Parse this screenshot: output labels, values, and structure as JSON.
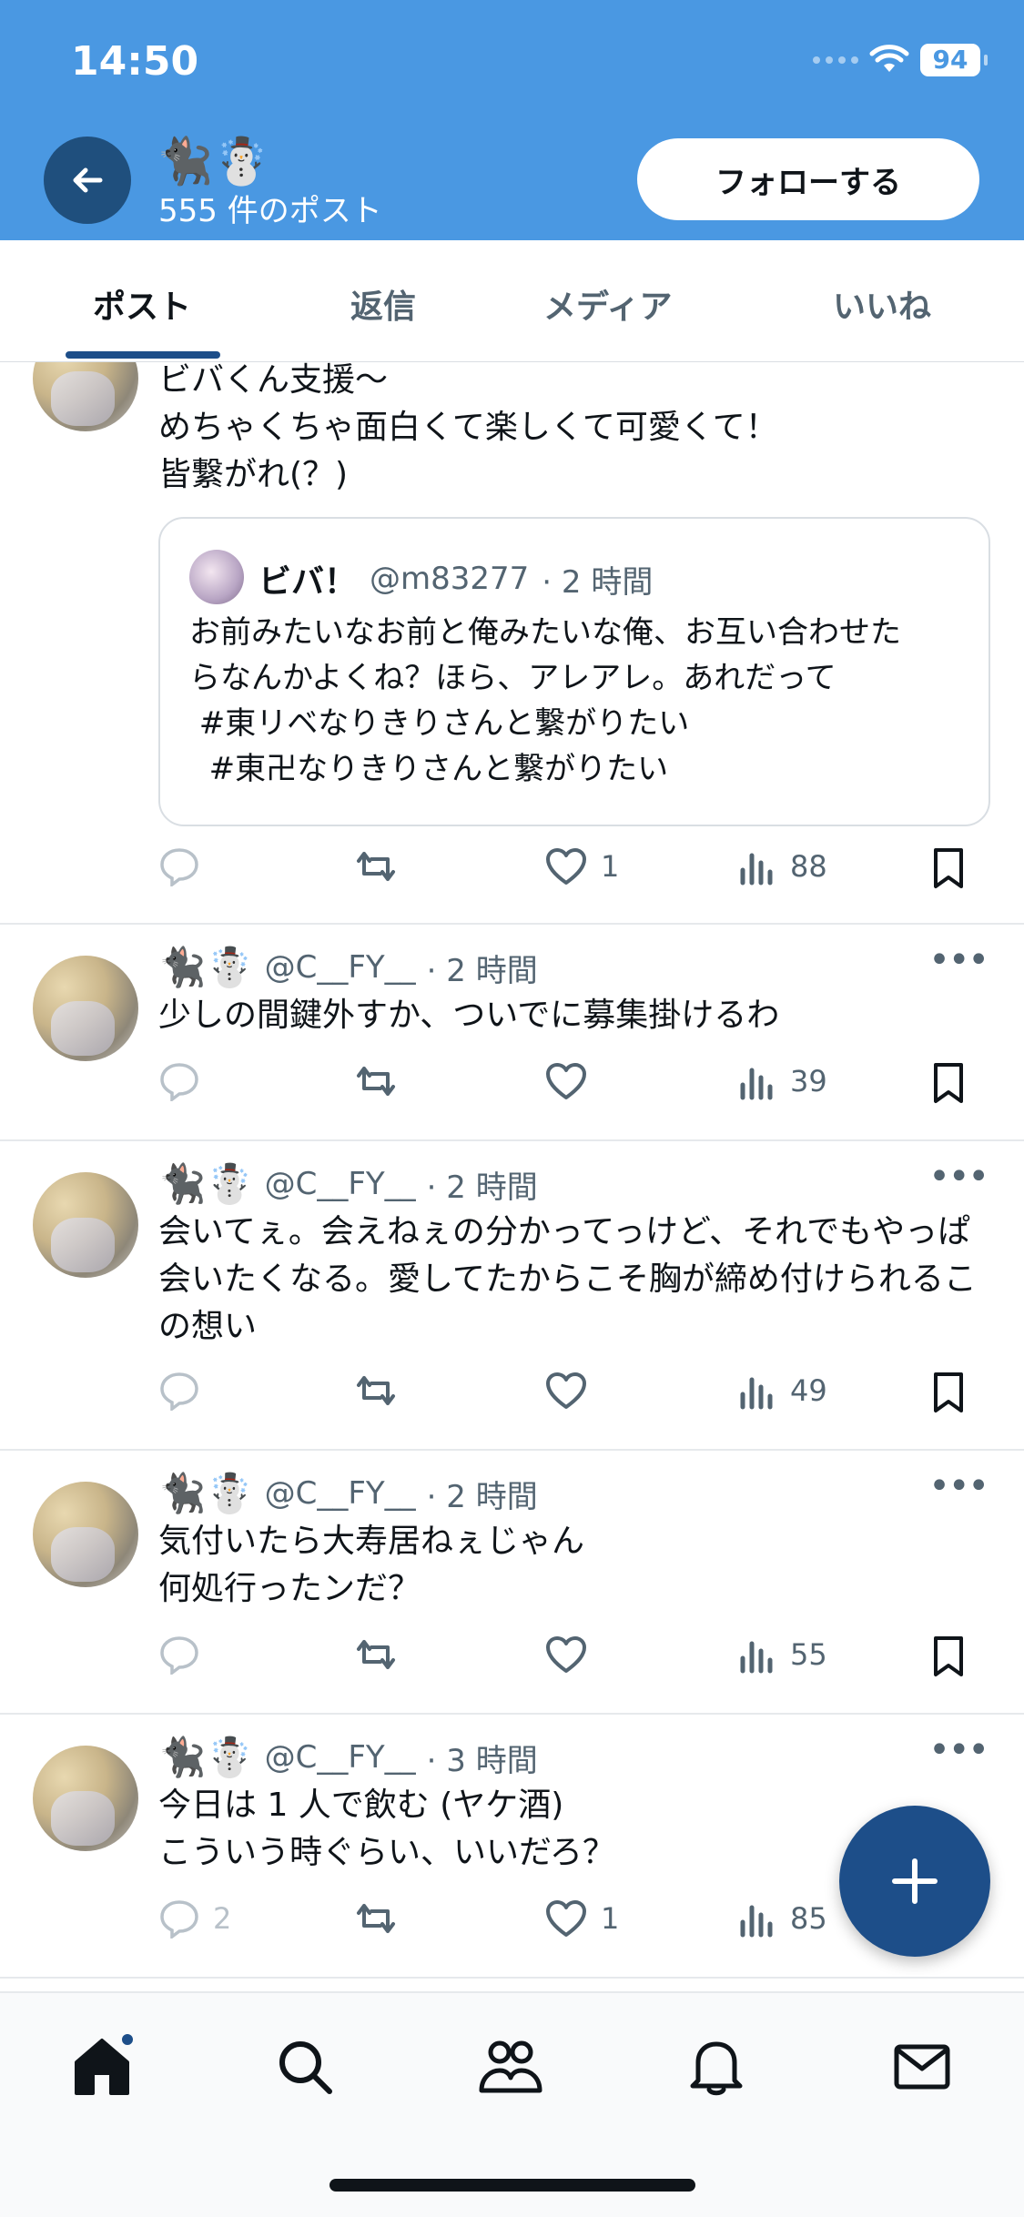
{
  "status_bar": {
    "time": "14:50",
    "battery": "94"
  },
  "header": {
    "profile_emoji": "🐈‍⬛☃️",
    "post_count": "555 件のポスト",
    "follow_label": "フォローする"
  },
  "tabs": [
    {
      "label": "ポスト"
    },
    {
      "label": "返信"
    },
    {
      "label": "メディア"
    },
    {
      "label": "いいね"
    }
  ],
  "posts": [
    {
      "text_lines": [
        "ビバくん支援〜",
        "めちゃくちゃ面白くて楽しくて可愛くて！",
        "皆繋がれ(？)"
      ],
      "quote": {
        "name": "ビバ！",
        "handle": "@m83277",
        "time": "· 2 時間",
        "text_lines": [
          "お前みたいなお前と俺みたいな俺、お互い合わせた",
          "らなんかよくね？ほら、アレアレ。あれだって",
          " #東リベなりきりさんと繋がりたい",
          "  #東卍なりきりさんと繋がりたい"
        ]
      },
      "replies": "",
      "likes": "1",
      "views": "88"
    },
    {
      "emoji": "🐈‍⬛☃️",
      "handle": "@C__FY__",
      "time": "· 2 時間",
      "text_lines": [
        "少しの間鍵外すか、ついでに募集掛けるわ"
      ],
      "replies": "",
      "likes": "",
      "views": "39"
    },
    {
      "emoji": "🐈‍⬛☃️",
      "handle": "@C__FY__",
      "time": "· 2 時間",
      "text_lines": [
        "会いてぇ。会えねぇの分かってっけど、それでもやっぱ",
        "会いたくなる。愛してたからこそ胸が締め付けられるこ",
        "の想い"
      ],
      "replies": "",
      "likes": "",
      "views": "49"
    },
    {
      "emoji": "🐈‍⬛☃️",
      "handle": "@C__FY__",
      "time": "· 2 時間",
      "text_lines": [
        "気付いたら大寿居ねぇじゃん",
        "何処行ったンだ？"
      ],
      "replies": "",
      "likes": "",
      "views": "55"
    },
    {
      "emoji": "🐈‍⬛☃️",
      "handle": "@C__FY__",
      "time": "· 3 時間",
      "text_lines": [
        "今日は 1 人で飲む (ヤケ酒)",
        "こういう時ぐらい、いいだろ？"
      ],
      "replies": "2",
      "likes": "1",
      "views": "85"
    }
  ],
  "icons": {
    "back": "back-arrow-icon",
    "reply": "reply-icon",
    "repost": "repost-icon",
    "like": "heart-icon",
    "views": "views-icon",
    "bookmark": "bookmark-icon",
    "more": "more-icon",
    "compose": "plus-icon",
    "nav": [
      "home-icon",
      "search-icon",
      "communities-icon",
      "notifications-icon",
      "messages-icon"
    ]
  },
  "colors": {
    "header_bg": "#4a98e2",
    "accent": "#1d4e89",
    "muted": "#536471"
  }
}
